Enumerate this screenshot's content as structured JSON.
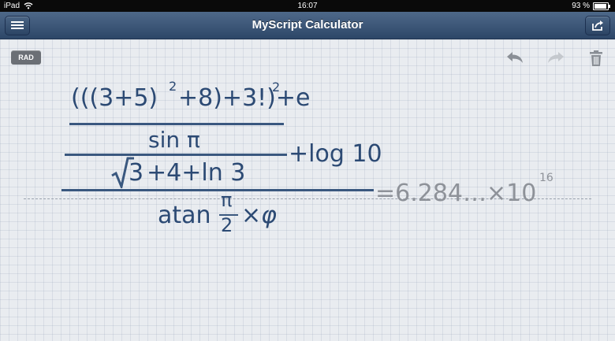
{
  "status_bar": {
    "device": "iPad",
    "time": "16:07",
    "battery": "93 %",
    "battery_level": 0.93
  },
  "app": {
    "title": "MyScript Calculator"
  },
  "toolbar": {
    "mode": "RAD",
    "icons": [
      "menu-icon",
      "share-icon",
      "undo-icon",
      "redo-icon",
      "trash-icon"
    ]
  },
  "expression": {
    "line1": "(((3+5)",
    "line1_exp": "2",
    "line1_b": "+8)+3!)+e",
    "line1_exp2": "2",
    "sin": "sin π",
    "plus_log": "+log 10",
    "sqrt_arg": "3",
    "sqrt_rest": "+4+ln 3",
    "atan": "atan",
    "pi": "π",
    "two": "2",
    "phi": "×φ"
  },
  "result": {
    "mantissa": "=6.284…×10",
    "exponent": "16"
  },
  "colors": {
    "ink": "#2c4a74",
    "result": "#8e9299",
    "navbar": "#3a5578"
  }
}
